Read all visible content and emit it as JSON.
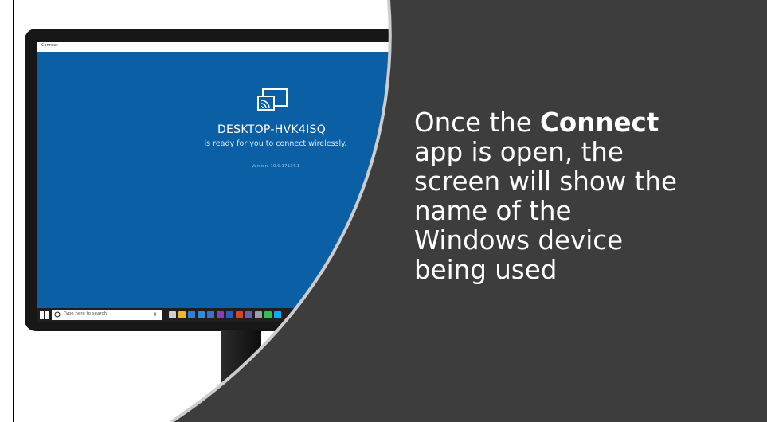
{
  "app": {
    "title": "Connect",
    "device_name": "DESKTOP-HVK4ISQ",
    "ready_message": "is ready for you to connect wirelessly.",
    "version": "Version: 10.0.17134.1"
  },
  "taskbar": {
    "search_placeholder": "Type here to search",
    "apps": [
      {
        "name": "task-view-icon",
        "color": "#cfcfcf"
      },
      {
        "name": "file-explorer-icon",
        "color": "#e8b83a"
      },
      {
        "name": "mail-icon",
        "color": "#2f7fd6"
      },
      {
        "name": "edge-icon",
        "color": "#2a8fe0"
      },
      {
        "name": "store-icon",
        "color": "#3b6fd0"
      },
      {
        "name": "onenote-icon",
        "color": "#8a3db6"
      },
      {
        "name": "word-icon",
        "color": "#2b5fb4"
      },
      {
        "name": "powerpoint-icon",
        "color": "#d24726"
      },
      {
        "name": "teams-icon",
        "color": "#6264a7"
      },
      {
        "name": "settings-icon",
        "color": "#9e9e9e"
      },
      {
        "name": "chrome-icon",
        "color": "#3cba54"
      },
      {
        "name": "skype-icon",
        "color": "#00aff0"
      }
    ]
  },
  "caption": {
    "line1_prefix": "Once the ",
    "line1_bold": "Connect",
    "line2": "app is open, the",
    "line3": "screen will show the",
    "line4": "name of the",
    "line5": "Windows device",
    "line6": "being used"
  },
  "colors": {
    "panel": "#3d3d3d",
    "screen": "#0b5fa5",
    "panel_edge": "#cccccc"
  }
}
